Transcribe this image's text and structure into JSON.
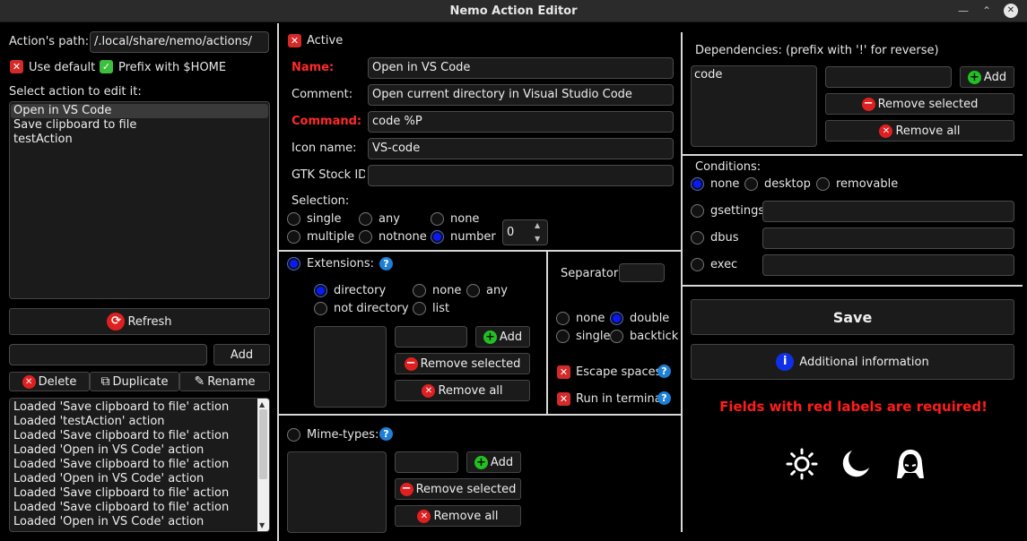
{
  "window": {
    "title": "Nemo Action Editor"
  },
  "left": {
    "path_label": "Action's path:",
    "path_value": "/.local/share/nemo/actions/",
    "use_default_label": "Use default",
    "prefix_home_label": "Prefix with $HOME",
    "select_label": "Select action to edit it:",
    "actions": [
      "Open in VS Code",
      "Save clipboard to file",
      "testAction"
    ],
    "selected_action": 0,
    "refresh_label": "Refresh",
    "add_label": "Add",
    "delete_label": "Delete",
    "duplicate_label": "Duplicate",
    "rename_label": "Rename",
    "log": [
      "Loaded 'Save clipboard to file' action",
      "Loaded 'testAction' action",
      "Loaded 'Save clipboard to file' action",
      "Loaded 'Open in VS Code' action",
      "Loaded 'Save clipboard to file' action",
      "Loaded 'Open in VS Code' action",
      "Loaded 'Save clipboard to file' action",
      "Loaded 'Save clipboard to file' action",
      "Loaded 'Open in VS Code' action"
    ]
  },
  "middle": {
    "active_label": "Active",
    "name_label": "Name:",
    "name_value": "Open in VS Code",
    "comment_label": "Comment:",
    "comment_value": "Open current directory in Visual Studio Code",
    "command_label": "Command:",
    "command_value": "code %P",
    "icon_label": "Icon name:",
    "icon_value": "VS-code",
    "stock_label": "GTK Stock ID",
    "stock_value": "",
    "selection_label": "Selection:",
    "selection_options": [
      "single",
      "any",
      "none",
      "multiple",
      "notnone",
      "number"
    ],
    "selection_selected": "number",
    "number_value": "0",
    "extensions_label": "Extensions:",
    "ext_options": [
      "directory",
      "none",
      "any",
      "not directory",
      "list"
    ],
    "ext_selected": "directory",
    "add_label": "Add",
    "remove_selected_label": "Remove selected",
    "remove_all_label": "Remove all",
    "separator_label": "Separator:",
    "separator_value": "",
    "quote_options": [
      "none",
      "double",
      "single",
      "backtick"
    ],
    "quote_selected": "double",
    "escape_label": "Escape spaces",
    "terminal_label": "Run in terminal",
    "mime_label": "Mime-types:"
  },
  "right": {
    "deps_label": "Dependencies: (prefix with '!' for reverse)",
    "deps": [
      "code"
    ],
    "add_label": "Add",
    "remove_selected_label": "Remove selected",
    "remove_all_label": "Remove all",
    "conditions_label": "Conditions:",
    "cond_options": [
      "none",
      "desktop",
      "removable"
    ],
    "cond_selected": "none",
    "gsettings_label": "gsettings",
    "dbus_label": "dbus",
    "exec_label": "exec",
    "save_label": "Save",
    "info_label": "Additional information",
    "required_note": "Fields with red labels are required!"
  },
  "colors": {
    "accent_red": "#ff2a2a",
    "radio_on": "#0a18ff",
    "help_blue": "#1e7fd6"
  }
}
